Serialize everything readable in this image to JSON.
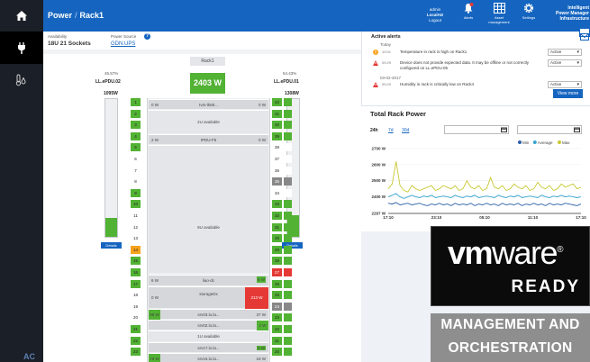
{
  "header": {
    "breadcrumb_root": "Power",
    "breadcrumb_sep": "/",
    "breadcrumb_current": "Rack1",
    "user": {
      "role": "admin",
      "name": "LocalAD",
      "logout": "Logout"
    },
    "buttons": {
      "alerts": "Alerts",
      "asset": "Asset management",
      "settings": "Settings"
    },
    "brand": {
      "line1": "Intelligent",
      "line2": "Power Manager",
      "line3": "Infrastructure"
    }
  },
  "rack": {
    "availability_label": "Availability",
    "availability_value": "18U  21 Sockets",
    "power_source_label": "Power Source",
    "power_source_value": "GDN.UPS",
    "title": "Rack1",
    "power": "2403 W",
    "left_pdu": {
      "percent": "45.57%",
      "name": "LL.ePDU.02",
      "watts": "1095W",
      "details": "Details",
      "fill_pct": 14
    },
    "right_pdu": {
      "percent": "54.43%",
      "name": "LL.ePDU.01",
      "watts": "1308W",
      "details": "Details",
      "fill_pct": 16
    },
    "available_2u": "2U available",
    "available_9u": "9U available",
    "available_1u": "1U available",
    "dev_labels": [
      "Ivm-lkMt...",
      "IPDU-F5",
      "liao-dc",
      "storageDx",
      "srv03.lo.la...",
      "srv02.lo.la...",
      "srv17.lo.la...",
      "srv16.lo.la...",
      "srv15.lo.la...",
      "srv15.lo.la..."
    ],
    "watt_labels": [
      "0 W",
      "0 W",
      "2 W",
      "0 W",
      "6 W",
      "0 W",
      "6 W",
      "213 W",
      "88 W",
      "37 W",
      "2 W",
      "5 W",
      "79 W",
      "18 W",
      "82 W",
      "0 W",
      "0 W"
    ],
    "left_col": [
      "1",
      "2",
      "3",
      "4",
      "5",
      "6",
      "7",
      "8",
      "9",
      "10",
      "11",
      "12",
      "13",
      "14",
      "15",
      "16",
      "17",
      "18",
      "19",
      "20",
      "21",
      "22",
      "23"
    ],
    "right_col": [
      "42",
      "41",
      "40",
      "39",
      "38",
      "37",
      "36",
      "35",
      "34",
      "33",
      "32",
      "31",
      "30",
      "29",
      "28",
      "27",
      "26",
      "25",
      "24",
      "23",
      "22",
      "21",
      "20"
    ]
  },
  "alerts": {
    "title": "Active alerts",
    "today": "Today",
    "rows": [
      {
        "time": "10:01",
        "msg": "Temperature in rack is high on Rack1",
        "status": "Active"
      },
      {
        "time": "09:29",
        "msg": "Device does not provide expected data. It may be offline or not correctly configured on LL.ePDU.05",
        "status": "Active"
      },
      {
        "time": "09:29",
        "msg": "Humidity in rack is critically low on Rack4",
        "status": "Active"
      }
    ],
    "date2": "03-02-2017",
    "view_more": "View more"
  },
  "total_power": {
    "title": "Total Rack Power",
    "ranges": [
      "24h",
      "7d",
      "30d"
    ],
    "legend": [
      "Min",
      "Average",
      "Max"
    ]
  },
  "chart_data": {
    "type": "line",
    "x": [
      "17:10",
      "23:10",
      "05:10",
      "11:10",
      "17:10"
    ],
    "ylim": [
      2297,
      2700
    ],
    "yticks": [
      2297,
      2400,
      2500,
      2600,
      2700
    ],
    "ytick_labels": [
      "2297 W",
      "2400 W",
      "2500 W",
      "2600 W",
      "2700 W"
    ],
    "series": [
      {
        "name": "Max",
        "color": "#c8c832",
        "values": [
          2450,
          2480,
          2620,
          2470,
          2440,
          2430,
          2470,
          2450,
          2440,
          2450,
          2460,
          2470,
          2440,
          2450,
          2470,
          2460,
          2450,
          2470,
          2440,
          2450,
          2500,
          2460,
          2450,
          2470,
          2440,
          2450,
          2520,
          2460,
          2450,
          2470,
          2440,
          2450,
          2480,
          2460,
          2450,
          2470,
          2440,
          2450,
          2490,
          2460,
          2450,
          2470,
          2440,
          2450,
          2480,
          2460,
          2470,
          2480,
          2450,
          2460
        ]
      },
      {
        "name": "Average",
        "color": "#37a6d0",
        "values": [
          2400,
          2410,
          2420,
          2400,
          2390,
          2400,
          2410,
          2400,
          2395,
          2405,
          2400,
          2410,
          2395,
          2400,
          2405,
          2400,
          2395,
          2410,
          2400,
          2395,
          2405,
          2400,
          2410,
          2395,
          2400,
          2405,
          2400,
          2395,
          2410,
          2400,
          2395,
          2405,
          2400,
          2410,
          2395,
          2400,
          2405,
          2400,
          2395,
          2410,
          2400,
          2395,
          2405,
          2400,
          2410,
          2400,
          2405,
          2400,
          2395,
          2400
        ]
      },
      {
        "name": "Min",
        "color": "#2c5fa8",
        "values": [
          2360,
          2355,
          2365,
          2350,
          2355,
          2360,
          2350,
          2355,
          2360,
          2350,
          2345,
          2355,
          2350,
          2360,
          2350,
          2355,
          2345,
          2360,
          2350,
          2355,
          2350,
          2360,
          2345,
          2355,
          2350,
          2360,
          2350,
          2355,
          2345,
          2360,
          2350,
          2355,
          2350,
          2360,
          2345,
          2355,
          2350,
          2360,
          2350,
          2355,
          2345,
          2360,
          2350,
          2355,
          2350,
          2360,
          2355,
          2350,
          2345,
          2355
        ]
      }
    ]
  },
  "vmware": {
    "logo_vm": "vm",
    "logo_ware": "ware",
    "reg": "®",
    "ready": "READY"
  },
  "mgmt": {
    "line1": "MANAGEMENT AND",
    "line2": "ORCHESTRATION"
  },
  "corner_text": "AC"
}
